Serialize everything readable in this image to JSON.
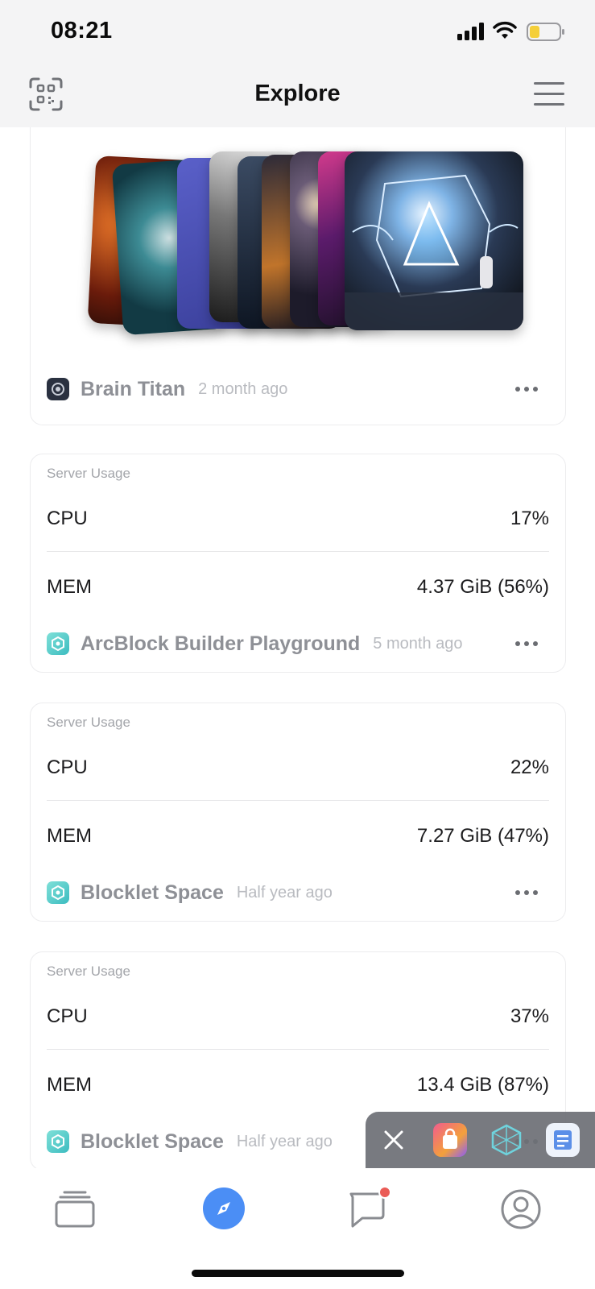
{
  "status_bar": {
    "time": "08:21"
  },
  "header": {
    "title": "Explore"
  },
  "feed": [
    {
      "type": "gallery",
      "app_name": "Brain Titan",
      "time_ago": "2 month ago"
    },
    {
      "type": "server_usage",
      "section_label": "Server Usage",
      "cpu_label": "CPU",
      "cpu_value": "17%",
      "mem_label": "MEM",
      "mem_value": "4.37 GiB (56%)",
      "app_name": "ArcBlock Builder Playground",
      "time_ago": "5 month ago"
    },
    {
      "type": "server_usage",
      "section_label": "Server Usage",
      "cpu_label": "CPU",
      "cpu_value": "22%",
      "mem_label": "MEM",
      "mem_value": "7.27 GiB (47%)",
      "app_name": "Blocklet Space",
      "time_ago": "Half year ago"
    },
    {
      "type": "server_usage",
      "section_label": "Server Usage",
      "cpu_label": "CPU",
      "cpu_value": "37%",
      "mem_label": "MEM",
      "mem_value": "13.4 GiB (87%)",
      "app_name": "Blocklet Space",
      "time_ago": "Half year ago"
    }
  ],
  "tabbar": {
    "tabs": [
      {
        "name": "stack",
        "icon": "cards-stack-icon"
      },
      {
        "name": "explore",
        "icon": "compass-icon",
        "active": true
      },
      {
        "name": "messages",
        "icon": "chat-bubble-icon",
        "has_badge": true
      },
      {
        "name": "profile",
        "icon": "user-circle-icon"
      }
    ]
  },
  "floating_switcher": {
    "apps": [
      "shopping-bag-icon",
      "arcblock-icon",
      "document-icon"
    ]
  },
  "colors": {
    "accent": "#4b8ef5",
    "badge": "#ea5b56",
    "app_teal": "#3cbcc0"
  }
}
